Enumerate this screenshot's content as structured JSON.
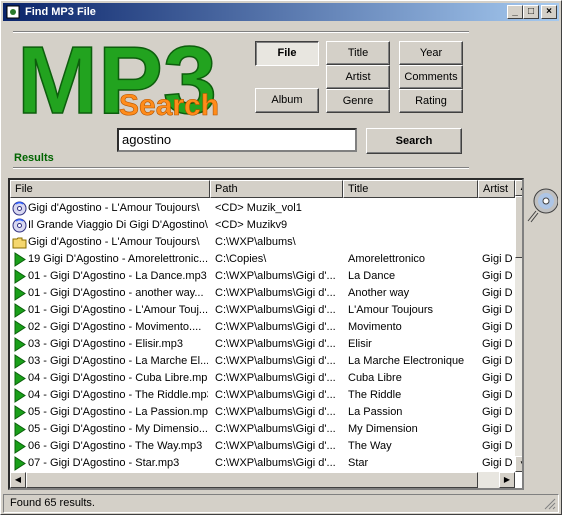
{
  "window": {
    "title": "Find MP3 File"
  },
  "titlebar_buttons": {
    "minimize": "_",
    "maximize": "□",
    "close": "×"
  },
  "logo": {
    "big": "MP3",
    "small": "Search"
  },
  "buttons": {
    "file": "File",
    "album": "Album",
    "title": "Title",
    "artist": "Artist",
    "genre": "Genre",
    "year": "Year",
    "comments": "Comments",
    "rating": "Rating",
    "search": "Search"
  },
  "search": {
    "value": "agostino"
  },
  "results_label": "Results",
  "columns": [
    "File",
    "Path",
    "Title",
    "Artist"
  ],
  "rows": [
    {
      "icon": "cd-icon",
      "file": "Gigi d'Agostino - L'Amour Toujours\\",
      "path": "<CD> Muzik_vol1",
      "title": "",
      "artist": ""
    },
    {
      "icon": "cd-icon",
      "file": "Il Grande Viaggio Di Gigi D'Agostino\\",
      "path": "<CD> Muzikv9",
      "title": "",
      "artist": ""
    },
    {
      "icon": "folder-icon",
      "file": "Gigi d'Agostino - L'Amour Toujours\\",
      "path": "C:\\WXP\\albums\\",
      "title": "",
      "artist": ""
    },
    {
      "icon": "play-icon",
      "file": "19 Gigi D'Agostino - Amorelettronic...",
      "path": "C:\\Copies\\",
      "title": "Amorelettronico",
      "artist": "Gigi D"
    },
    {
      "icon": "play-icon",
      "file": "01 - Gigi D'Agostino - La Dance.mp3",
      "path": "C:\\WXP\\albums\\Gigi d'...",
      "title": "La Dance",
      "artist": "Gigi D"
    },
    {
      "icon": "play-icon",
      "file": "01 - Gigi D'Agostino - another way...",
      "path": "C:\\WXP\\albums\\Gigi d'...",
      "title": "Another way",
      "artist": "Gigi D"
    },
    {
      "icon": "play-icon",
      "file": "01 - Gigi D'Agostino - L'Amour Touj...",
      "path": "C:\\WXP\\albums\\Gigi d'...",
      "title": "L'Amour Toujours",
      "artist": "Gigi D"
    },
    {
      "icon": "play-icon",
      "file": "02 - Gigi D'Agostino - Movimento....",
      "path": "C:\\WXP\\albums\\Gigi d'...",
      "title": "Movimento",
      "artist": "Gigi D"
    },
    {
      "icon": "play-icon",
      "file": "03 - Gigi D'Agostino - Elisir.mp3",
      "path": "C:\\WXP\\albums\\Gigi d'...",
      "title": "Elisir",
      "artist": "Gigi D"
    },
    {
      "icon": "play-icon",
      "file": "03 - Gigi D'Agostino - La Marche El...",
      "path": "C:\\WXP\\albums\\Gigi d'...",
      "title": "La Marche Electronique",
      "artist": "Gigi D"
    },
    {
      "icon": "play-icon",
      "file": "04 - Gigi D'Agostino - Cuba Libre.mp3",
      "path": "C:\\WXP\\albums\\Gigi d'...",
      "title": "Cuba Libre",
      "artist": "Gigi D"
    },
    {
      "icon": "play-icon",
      "file": "04 - Gigi D'Agostino - The Riddle.mp3",
      "path": "C:\\WXP\\albums\\Gigi d'...",
      "title": "The Riddle",
      "artist": "Gigi D"
    },
    {
      "icon": "play-icon",
      "file": "05 - Gigi D'Agostino - La Passion.mp3",
      "path": "C:\\WXP\\albums\\Gigi d'...",
      "title": "La Passion",
      "artist": "Gigi D"
    },
    {
      "icon": "play-icon",
      "file": "05 - Gigi D'Agostino - My Dimensio...",
      "path": "C:\\WXP\\albums\\Gigi d'...",
      "title": "My Dimension",
      "artist": "Gigi D"
    },
    {
      "icon": "play-icon",
      "file": "06 - Gigi D'Agostino - The Way.mp3",
      "path": "C:\\WXP\\albums\\Gigi d'...",
      "title": "The Way",
      "artist": "Gigi D"
    },
    {
      "icon": "play-icon",
      "file": "07 - Gigi D'Agostino - Star.mp3",
      "path": "C:\\WXP\\albums\\Gigi d'...",
      "title": "Star",
      "artist": "Gigi D"
    }
  ],
  "status": "Found 65 results.",
  "colors": {
    "results_green": "#006400",
    "logo_green": "#22a31f",
    "logo_orange": "#ff8c1a",
    "titlebar": "#0a246a"
  }
}
